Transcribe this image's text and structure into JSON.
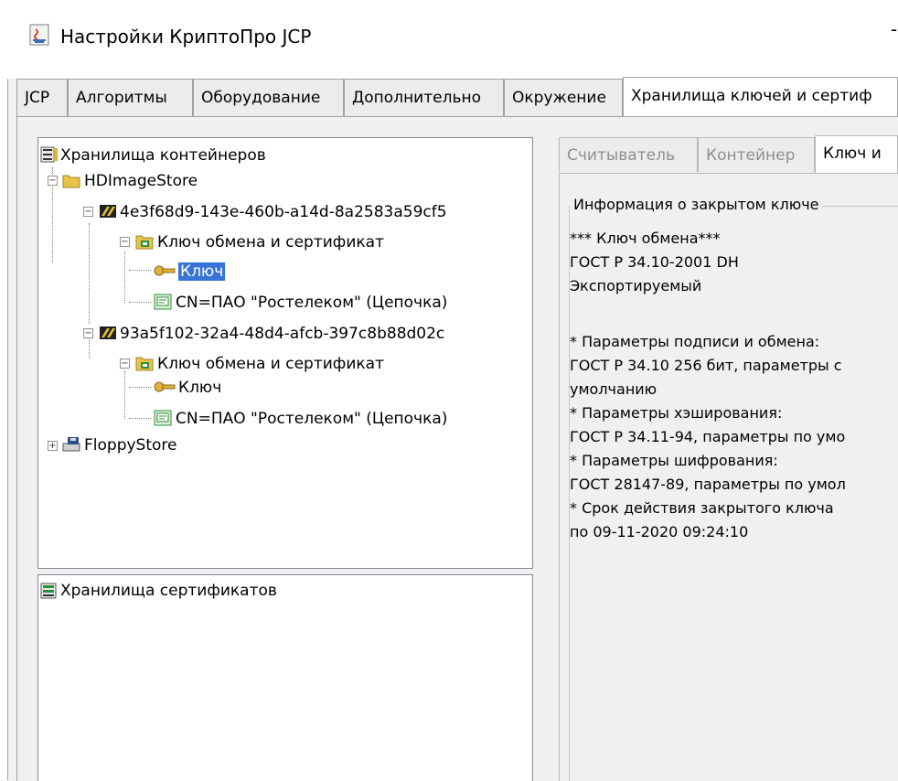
{
  "window": {
    "title": "Настройки КриптоПро JCP",
    "minimize_glyph": "-"
  },
  "tabs": [
    {
      "label": "JCP"
    },
    {
      "label": "Алгоритмы"
    },
    {
      "label": "Оборудование"
    },
    {
      "label": "Дополнительно"
    },
    {
      "label": "Окружение"
    },
    {
      "label": "Хранилища ключей и сертиф",
      "active": true
    }
  ],
  "container_tree": {
    "root": "Хранилища контейнеров",
    "store1": "HDImageStore",
    "container1": "4e3f68d9-143e-460b-a14d-8a2583a59cf5",
    "container1_pair": "Ключ обмена и сертификат",
    "container1_key": "Ключ",
    "container1_cert": "CN=ПАО \"Ростелеком\" (Цепочка)",
    "container2": "93a5f102-32a4-48d4-afcb-397c8b88d02c",
    "container2_pair": "Ключ обмена и сертификат",
    "container2_key": "Ключ",
    "container2_cert": "CN=ПАО \"Ростелеком\" (Цепочка)",
    "store2": "FloppyStore",
    "selected": "container1_key"
  },
  "cert_tree": {
    "root": "Хранилища сертификатов"
  },
  "inner_tabs": [
    {
      "label": "Считыватель"
    },
    {
      "label": "Контейнер"
    },
    {
      "label": "Ключ и",
      "active": true
    }
  ],
  "key_info": {
    "group_title": "Информация о закрытом ключе",
    "lines": [
      "*** Ключ обмена***",
      "ГОСТ Р 34.10-2001 DH",
      "Экспортируемый",
      "",
      " * Параметры подписи и обмена:",
      "ГОСТ Р 34.10 256 бит, параметры с",
      "умолчанию",
      " * Параметры хэширования:",
      "ГОСТ Р 34.11-94, параметры по умо",
      " * Параметры шифрования:",
      "ГОСТ 28147-89, параметры по умол",
      " * Срок действия закрытого ключа",
      "по 09-11-2020 09:24:10"
    ]
  },
  "colors": {
    "selection": "#3874d8",
    "folder": "#e8c34a",
    "cert_green": "#2f8f3a"
  }
}
